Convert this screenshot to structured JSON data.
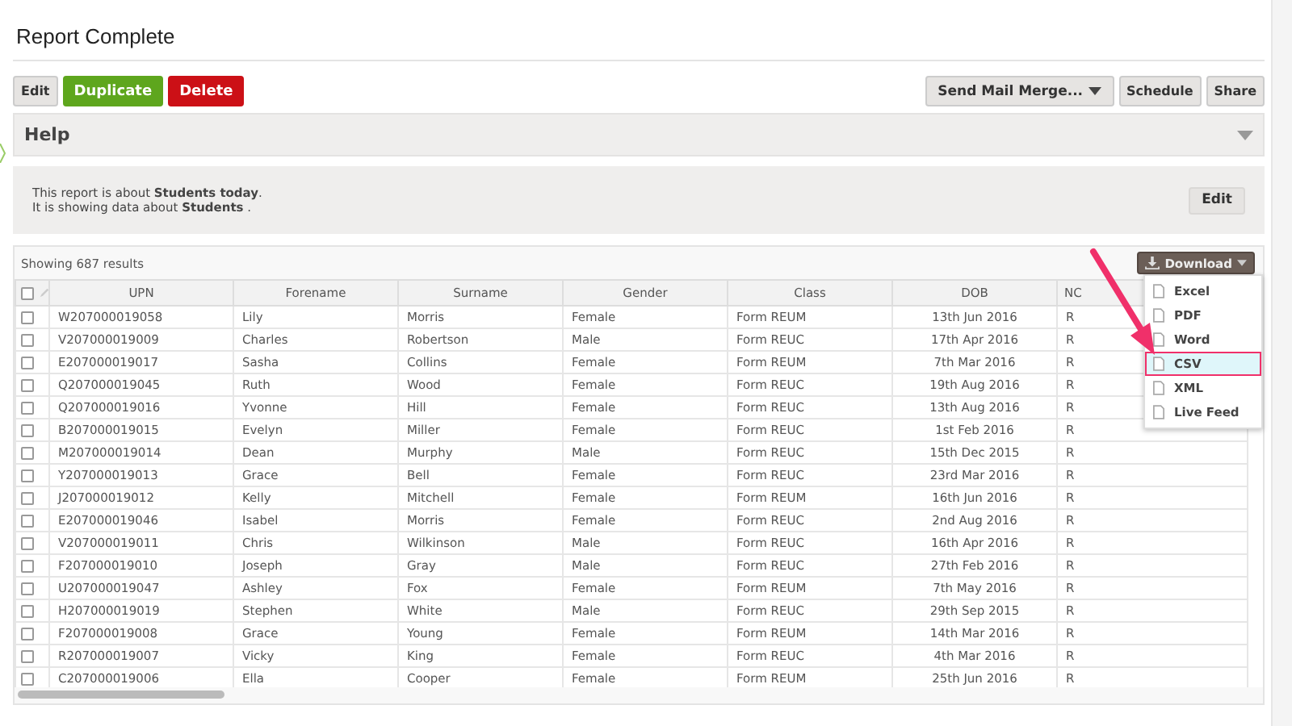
{
  "title": "Report Complete",
  "actions_left": [
    {
      "label": "Edit",
      "kind": "plain"
    },
    {
      "label": "Duplicate",
      "kind": "success"
    },
    {
      "label": "Delete",
      "kind": "danger"
    }
  ],
  "actions_right": [
    {
      "label": "Send Mail Merge...",
      "kind": "dropdown"
    },
    {
      "label": "Schedule",
      "kind": "plain"
    },
    {
      "label": "Share",
      "kind": "plain"
    }
  ],
  "help": {
    "title": "Help",
    "expanded": false,
    "text": "This report is about **Students today**.",
    "text2": "It is showing data about **Students** .",
    "edit": "Edit"
  },
  "results": {
    "summary": "Showing 687 results",
    "download": "Download",
    "download_menu": [
      {
        "label": "Excel",
        "selected": false
      },
      {
        "label": "PDF",
        "selected": false
      },
      {
        "label": "Word",
        "selected": false
      },
      {
        "label": "CSV",
        "selected": true
      },
      {
        "label": "XML",
        "selected": false
      },
      {
        "label": "Live Feed",
        "selected": false
      }
    ],
    "select_all_checked": false,
    "columns": [
      "UPN",
      "Forename",
      "Surname",
      "Gender",
      "Class",
      "DOB",
      "NC"
    ],
    "rows": [
      {
        "checked": false,
        "cells": [
          "W207000019058",
          "Lily",
          "Morris",
          "Female",
          "Form REUM",
          "13th Jun 2016",
          "R"
        ]
      },
      {
        "checked": false,
        "cells": [
          "V207000019009",
          "Charles",
          "Robertson",
          "Male",
          "Form REUC",
          "17th Apr 2016",
          "R"
        ]
      },
      {
        "checked": false,
        "cells": [
          "E207000019017",
          "Sasha",
          "Collins",
          "Female",
          "Form REUM",
          "7th Mar 2016",
          "R"
        ]
      },
      {
        "checked": false,
        "cells": [
          "Q207000019045",
          "Ruth",
          "Wood",
          "Female",
          "Form REUC",
          "19th Aug 2016",
          "R"
        ]
      },
      {
        "checked": false,
        "cells": [
          "Q207000019016",
          "Yvonne",
          "Hill",
          "Female",
          "Form REUC",
          "13th Aug 2016",
          "R"
        ]
      },
      {
        "checked": false,
        "cells": [
          "B207000019015",
          "Evelyn",
          "Miller",
          "Female",
          "Form REUC",
          "1st Feb 2016",
          "R"
        ]
      },
      {
        "checked": false,
        "cells": [
          "M207000019014",
          "Dean",
          "Murphy",
          "Male",
          "Form REUC",
          "15th Dec 2015",
          "R"
        ]
      },
      {
        "checked": false,
        "cells": [
          "Y207000019013",
          "Grace",
          "Bell",
          "Female",
          "Form REUC",
          "23rd Mar 2016",
          "R"
        ]
      },
      {
        "checked": false,
        "cells": [
          "J207000019012",
          "Kelly",
          "Mitchell",
          "Female",
          "Form REUM",
          "16th Jun 2016",
          "R"
        ]
      },
      {
        "checked": false,
        "cells": [
          "E207000019046",
          "Isabel",
          "Morris",
          "Female",
          "Form REUC",
          "2nd Aug 2016",
          "R"
        ]
      },
      {
        "checked": false,
        "cells": [
          "V207000019011",
          "Chris",
          "Wilkinson",
          "Male",
          "Form REUC",
          "16th Apr 2016",
          "R"
        ]
      },
      {
        "checked": false,
        "cells": [
          "F207000019010",
          "Joseph",
          "Gray",
          "Male",
          "Form REUC",
          "27th Feb 2016",
          "R"
        ]
      },
      {
        "checked": false,
        "cells": [
          "U207000019047",
          "Ashley",
          "Fox",
          "Female",
          "Form REUM",
          "7th May 2016",
          "R"
        ]
      },
      {
        "checked": false,
        "cells": [
          "H207000019019",
          "Stephen",
          "White",
          "Male",
          "Form REUC",
          "29th Sep 2015",
          "R"
        ]
      },
      {
        "checked": false,
        "cells": [
          "F207000019008",
          "Grace",
          "Young",
          "Female",
          "Form REUM",
          "14th Mar 2016",
          "R"
        ]
      },
      {
        "checked": false,
        "cells": [
          "R207000019007",
          "Vicky",
          "King",
          "Female",
          "Form REUC",
          "4th Mar 2016",
          "R"
        ]
      },
      {
        "checked": false,
        "cells": [
          "C207000019006",
          "Ella",
          "Cooper",
          "Female",
          "Form REUM",
          "25th Jun 2016",
          "R"
        ]
      }
    ]
  }
}
